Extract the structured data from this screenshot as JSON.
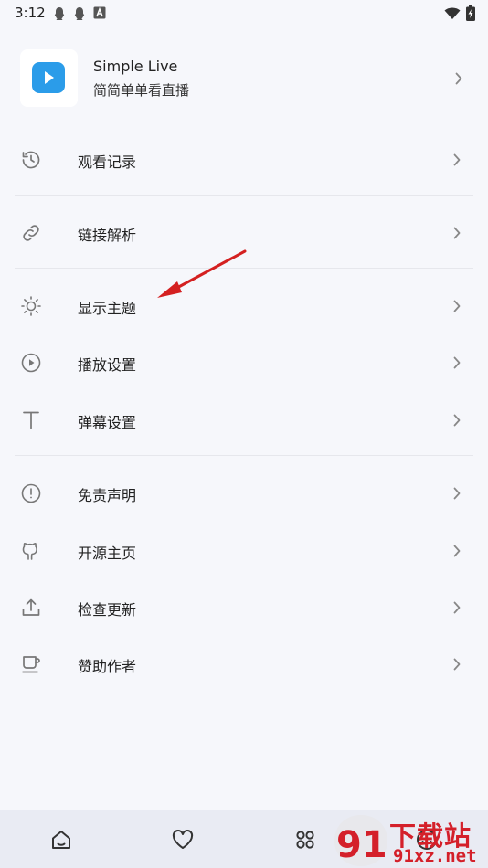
{
  "status_bar": {
    "time": "3:12",
    "left_icons": [
      "qq-penguin-icon",
      "qq-penguin-icon",
      "a-box-icon"
    ],
    "right_icons": [
      "wifi-icon",
      "battery-charging-icon"
    ]
  },
  "app_header": {
    "name": "Simple Live",
    "subtitle": "简简单单看直播",
    "logo_color": "#2b9ce9"
  },
  "menu_groups": [
    [
      {
        "label": "观看记录",
        "icon": "history-icon"
      }
    ],
    [
      {
        "label": "链接解析",
        "icon": "link-icon"
      }
    ],
    [
      {
        "label": "显示主题",
        "icon": "sun-icon"
      },
      {
        "label": "播放设置",
        "icon": "play-circle-icon"
      },
      {
        "label": "弹幕设置",
        "icon": "text-t-icon"
      }
    ],
    [
      {
        "label": "免责声明",
        "icon": "alert-circle-icon"
      },
      {
        "label": "开源主页",
        "icon": "github-icon"
      },
      {
        "label": "检查更新",
        "icon": "upload-icon"
      },
      {
        "label": "赞助作者",
        "icon": "coffee-cup-icon"
      }
    ]
  ],
  "bottom_nav": {
    "items": [
      "home-icon",
      "heart-icon",
      "grid-icon",
      "smile-icon"
    ]
  },
  "watermark": {
    "title": "下载站",
    "url": "91xz.net",
    "logo_text": "91"
  },
  "colors": {
    "background": "#f6f7fb",
    "divider": "#e6e7ec",
    "annotation_arrow": "#d42020",
    "nav_background": "#e9ebf3"
  }
}
